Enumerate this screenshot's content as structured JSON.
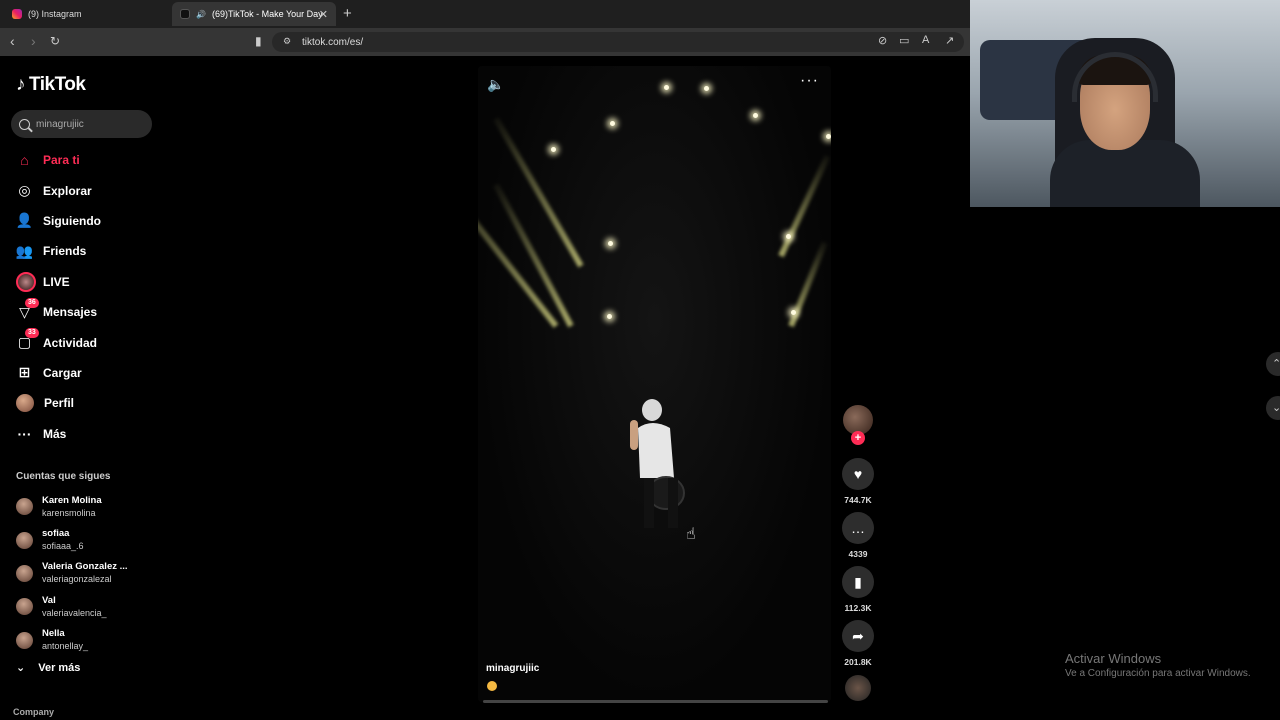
{
  "browser": {
    "tabs": [
      {
        "title": "(9) Instagram",
        "icon": "instagram-icon"
      },
      {
        "title": "(69)TikTok - Make Your Day",
        "icon": "tiktok-icon",
        "active": true
      }
    ],
    "new_tab": "+",
    "url": "tiktok.com/es/"
  },
  "brand": {
    "name": "TikTok"
  },
  "search": {
    "value": "minagrujiic"
  },
  "menu": [
    {
      "label": "Para ti",
      "icon": "home-icon",
      "active": true
    },
    {
      "label": "Explorar",
      "icon": "compass-icon"
    },
    {
      "label": "Siguiendo",
      "icon": "following-icon"
    },
    {
      "label": "Friends",
      "icon": "friends-icon"
    },
    {
      "label": "LIVE",
      "icon": "live-icon"
    },
    {
      "label": "Mensajes",
      "icon": "messages-icon",
      "badge": "36"
    },
    {
      "label": "Actividad",
      "icon": "activity-icon",
      "badge": "33"
    },
    {
      "label": "Cargar",
      "icon": "upload-icon"
    },
    {
      "label": "Perfil",
      "icon": "profile-avatar"
    },
    {
      "label": "Más",
      "icon": "more-icon"
    }
  ],
  "following": {
    "title": "Cuentas que sigues",
    "accounts": [
      {
        "name": "Karen Molina",
        "username": "karensmolina"
      },
      {
        "name": "sofiaa",
        "username": "sofiaaa_.6"
      },
      {
        "name": "Valeria Gonzalez ...",
        "username": "valeriagonzalezal"
      },
      {
        "name": "Val",
        "username": "valeriavalencia_"
      },
      {
        "name": "Nella",
        "username": "antonellay_"
      }
    ],
    "see_more": "Ver más"
  },
  "footer": {
    "company": "Company"
  },
  "video": {
    "author": "minagrujiic",
    "likes": "744.7K",
    "comments": "4339",
    "saves": "112.3K",
    "shares": "201.8K"
  },
  "watermark": {
    "title": "Activar Windows",
    "subtitle": "Ve a Configuración para activar Windows."
  },
  "colors": {
    "accent": "#fe2c55",
    "background": "#000000"
  }
}
